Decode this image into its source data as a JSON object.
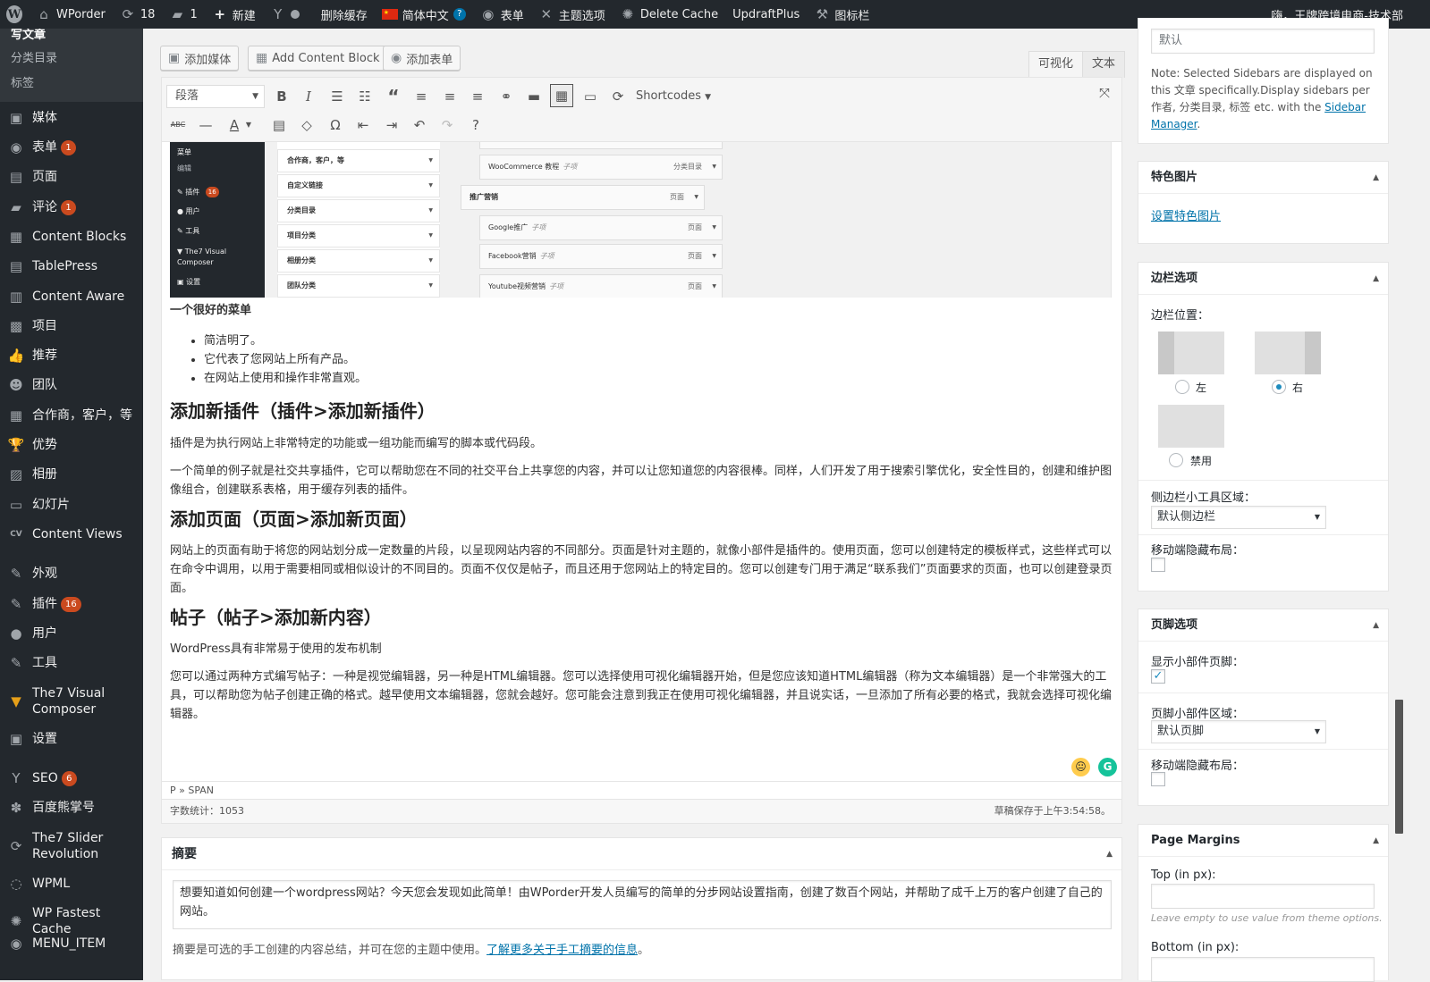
{
  "adminbar": {
    "site_name": "WPorder",
    "updates_count": "18",
    "comments_count": "1",
    "new_label": "新建",
    "clear_cache": "删除缓存",
    "language": "简体中文",
    "forms": "表单",
    "theme_options": "主题选项",
    "delete_cache": "Delete Cache",
    "updraftplus": "UpdraftPlus",
    "icon_bar": "图标栏",
    "greeting": "嗨，王牌跨境电商-技术部"
  },
  "menu": {
    "submenu": [
      "写文章",
      "分类目录",
      "标签"
    ],
    "items": [
      {
        "label": "媒体",
        "icon": "media-icon"
      },
      {
        "label": "表单",
        "icon": "forms-icon",
        "badge": "1"
      },
      {
        "label": "页面",
        "icon": "page-icon"
      },
      {
        "label": "评论",
        "icon": "comment-icon",
        "badge": "1"
      },
      {
        "label": "Content Blocks",
        "icon": "grid-icon"
      },
      {
        "label": "TablePress",
        "icon": "table-icon"
      },
      {
        "label": "Content Aware",
        "icon": "sidebar-icon"
      },
      {
        "label": "项目",
        "icon": "portfolio-icon"
      },
      {
        "label": "推荐",
        "icon": "thumbs-up-icon"
      },
      {
        "label": "团队",
        "icon": "team-icon"
      },
      {
        "label": "合作商，客户，等",
        "icon": "grid-icon"
      },
      {
        "label": "优势",
        "icon": "trophy-icon"
      },
      {
        "label": "相册",
        "icon": "gallery-icon"
      },
      {
        "label": "幻灯片",
        "icon": "slides-icon"
      },
      {
        "label": "Content Views",
        "icon": "cv-icon"
      },
      {
        "label": "外观",
        "icon": "appearance-icon"
      },
      {
        "label": "插件",
        "icon": "plugins-icon",
        "badge": "16"
      },
      {
        "label": "用户",
        "icon": "users-icon"
      },
      {
        "label": "工具",
        "icon": "tools-icon"
      },
      {
        "label": "The7 Visual Composer",
        "icon": "vc-icon"
      },
      {
        "label": "设置",
        "icon": "settings-icon"
      },
      {
        "label": "SEO",
        "icon": "seo-icon",
        "badge": "6"
      },
      {
        "label": "百度熊掌号",
        "icon": "paw-icon"
      },
      {
        "label": "The7 Slider Revolution",
        "icon": "slider-icon"
      },
      {
        "label": "WPML",
        "icon": "wpml-icon"
      },
      {
        "label": "WP Fastest Cache",
        "icon": "cheetah-icon"
      },
      {
        "label": "MENU_ITEM",
        "icon": "eye-icon"
      }
    ]
  },
  "editor": {
    "add_media": "添加媒体",
    "add_content_block": "Add Content Block",
    "add_form": "添加表单",
    "tab_visual": "可视化",
    "tab_text": "文本",
    "format_value": "段落",
    "shortcodes": "Shortcodes",
    "path": "P » SPAN",
    "word_count": "字数统计：1053",
    "draft_saved": "草稿保存于上午3:54:58。"
  },
  "menu_screenshot": {
    "side": [
      "菜单",
      "编辑",
      "插件",
      "16",
      "用户",
      "工具",
      "The7 Visual Composer",
      "设置"
    ],
    "list": [
      "合作商，客户，等",
      "自定义链接",
      "分类目录",
      "项目分类",
      "相册分类",
      "团队分类"
    ],
    "items": [
      {
        "title": "WooCommerce 教程",
        "sub": "子项",
        "type": "分类目录"
      },
      {
        "title": "推广营销",
        "sub": "",
        "type": "页面"
      },
      {
        "title": "Google推广",
        "sub": "子项",
        "type": "页面"
      },
      {
        "title": "Facebook营销",
        "sub": "子项",
        "type": "页面"
      },
      {
        "title": "Youtube视频营销",
        "sub": "子项",
        "type": "页面"
      }
    ]
  },
  "content": {
    "p_menu": "一个很好的菜单",
    "bullets": [
      "简洁明了。",
      "它代表了您网站上所有产品。",
      "在网站上使用和操作非常直观。"
    ],
    "h_plugins": "添加新插件（插件>添加新插件）",
    "p_plugins1": "插件是为执行网站上非常特定的功能或一组功能而编写的脚本或代码段。",
    "p_plugins2": "一个简单的例子就是社交共享插件，它可以帮助您在不同的社交平台上共享您的内容，并可以让您知道您的内容很棒。同样，人们开发了用于搜索引擎优化，安全性目的，创建和维护图像组合，创建联系表格，用于缓存列表的插件。",
    "h_pages": "添加页面（页面>添加新页面）",
    "p_pages": "网站上的页面有助于将您的网站划分成一定数量的片段，以呈现网站内容的不同部分。页面是针对主题的，就像小部件是插件的。使用页面，您可以创建特定的模板样式，这些样式可以在命令中调用，以用于需要相同或相似设计的不同目的。页面不仅仅是帖子，而且还用于您网站上的特定目的。您可以创建专门用于满足“联系我们”页面要求的页面，也可以创建登录页面。",
    "h_posts": "帖子（帖子>添加新内容）",
    "p_posts1": "WordPress具有非常易于使用的发布机制",
    "p_posts2": "您可以通过两种方式编写帖子：一种是视觉编辑器，另一种是HTML编辑器。您可以选择使用可视化编辑器开始，但是您应该知道HTML编辑器（称为文本编辑器）是一个非常强大的工具，可以帮助您为帖子创建正确的格式。越早使用文本编辑器，您就会越好。您可能会注意到我正在使用可视化编辑器，并且说实话，一旦添加了所有必要的格式，我就会选择可视化编辑器。"
  },
  "excerpt": {
    "title": "摘要",
    "text": "想要知道如何创建一个wordpress网站？今天您会发现如此简单！由WPorder开发人员编写的简单的分步网站设置指南，创建了数百个网站，并帮助了成千上万的客户创建了自己的网站。",
    "note": "摘要是可选的手工创建的内容总结，并可在您的主题中使用。",
    "note_link": "了解更多关于手工摘要的信息",
    "note_end": "。"
  },
  "sidebar": {
    "default_value": "默认",
    "note_pre": "Note: Selected Sidebars are displayed on this 文章 specifically.Display sidebars per 作者, 分类目录, 标签 etc. with the ",
    "note_link": "Sidebar Manager",
    "note_end": ".",
    "featured_title": "特色图片",
    "featured_link": "设置特色图片",
    "sidebar_opts_title": "边栏选项",
    "sidebar_position_label": "边栏位置：",
    "pos_left": "左",
    "pos_right": "右",
    "pos_disabled": "禁用",
    "widget_area_label": "侧边栏小工具区域：",
    "widget_area_value": "默认侧边栏",
    "mobile_hide_label": "移动端隐藏布局：",
    "footer_title": "页脚选项",
    "show_footer_label": "显示小部件页脚：",
    "footer_area_label": "页脚小部件区域：",
    "footer_area_value": "默认页脚",
    "footer_mobile_label": "移动端隐藏布局：",
    "margins_title": "Page Margins",
    "top_label": "Top (in px):",
    "margins_hint": "Leave empty to use value from theme options.",
    "bottom_label": "Bottom (in px):"
  }
}
